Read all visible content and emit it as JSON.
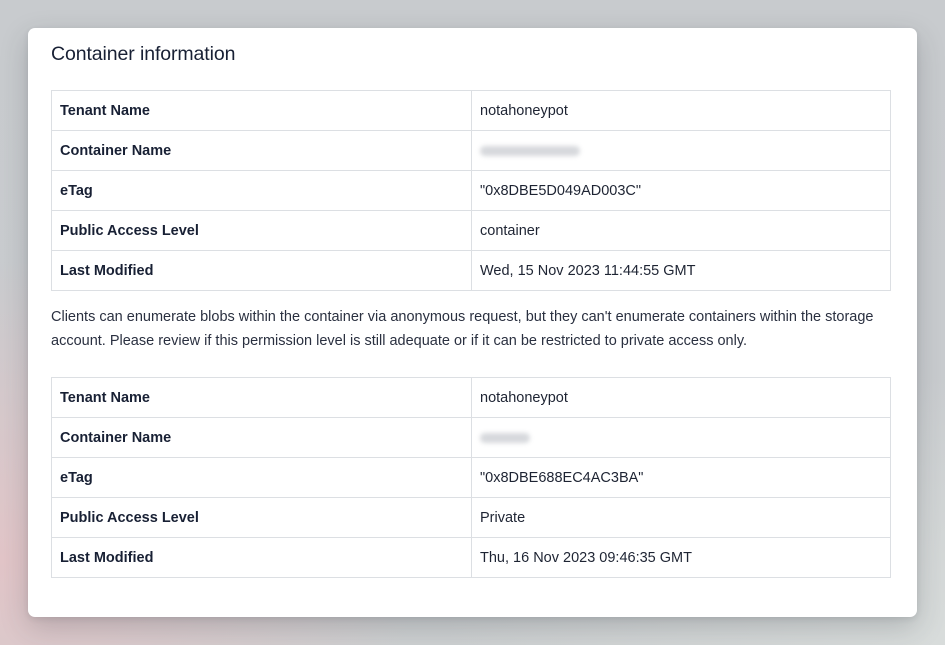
{
  "card": {
    "title": "Container information"
  },
  "containers": [
    {
      "rows": [
        {
          "key": "Tenant Name",
          "value": "notahoneypot"
        },
        {
          "key": "Container Name",
          "value": ""
        },
        {
          "key": "eTag",
          "value": "\"0x8DBE5D049AD003C\""
        },
        {
          "key": "Public Access Level",
          "value": "container"
        },
        {
          "key": "Last Modified",
          "value": "Wed, 15 Nov 2023 11:44:55 GMT"
        }
      ]
    },
    {
      "rows": [
        {
          "key": "Tenant Name",
          "value": "notahoneypot"
        },
        {
          "key": "Container Name",
          "value": ""
        },
        {
          "key": "eTag",
          "value": "\"0x8DBE688EC4AC3BA\""
        },
        {
          "key": "Public Access Level",
          "value": "Private"
        },
        {
          "key": "Last Modified",
          "value": "Thu, 16 Nov 2023 09:46:35 GMT"
        }
      ]
    }
  ],
  "description": "Clients can enumerate blobs within the container via anonymous request, but they can't enumerate containers within the storage account. Please review if this permission level is still adequate or if it can be restricted to private access only."
}
